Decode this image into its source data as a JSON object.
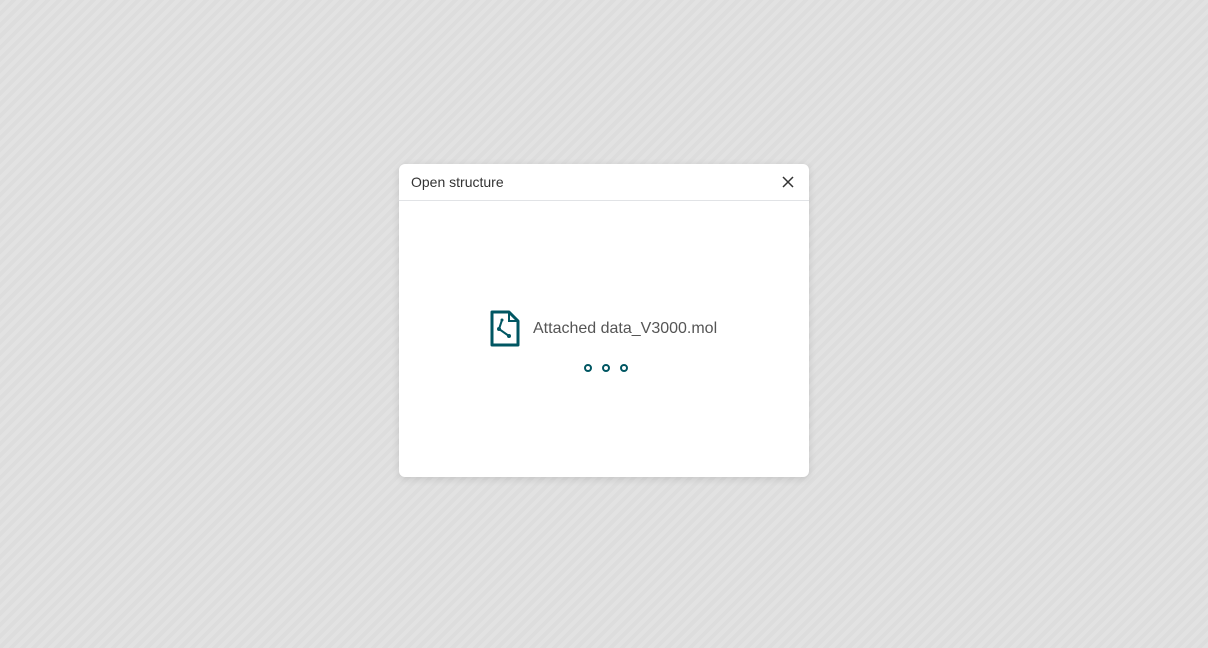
{
  "dialog": {
    "title": "Open structure",
    "close_icon": "close-icon",
    "file_icon": "structure-file-icon",
    "file_name": "Attached data_V3000.mol",
    "status": "loading",
    "accent_color": "#005662"
  }
}
